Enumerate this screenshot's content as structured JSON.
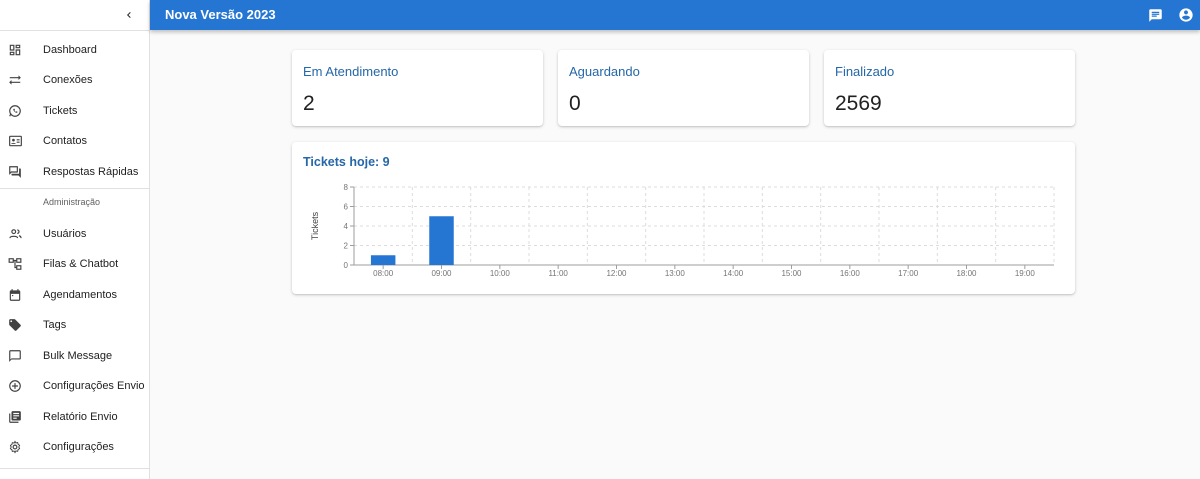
{
  "app": {
    "title": "Nova Versão 2023"
  },
  "sidebar": {
    "items": [
      {
        "label": "Dashboard",
        "icon": "dashboard-icon"
      },
      {
        "label": "Conexões",
        "icon": "sync-alt-icon"
      },
      {
        "label": "Tickets",
        "icon": "whatsapp-icon"
      },
      {
        "label": "Contatos",
        "icon": "contact-card-icon"
      },
      {
        "label": "Respostas Rápidas",
        "icon": "question-answer-icon"
      }
    ],
    "admin_header": "Administração",
    "admin_items": [
      {
        "label": "Usuários",
        "icon": "people-icon"
      },
      {
        "label": "Filas & Chatbot",
        "icon": "account-tree-icon"
      },
      {
        "label": "Agendamentos",
        "icon": "calendar-icon"
      },
      {
        "label": "Tags",
        "icon": "tag-icon"
      },
      {
        "label": "Bulk Message",
        "icon": "chat-bubble-icon"
      },
      {
        "label": "Configurações Envio",
        "icon": "add-circle-icon"
      },
      {
        "label": "Relatório Envio",
        "icon": "library-books-icon"
      },
      {
        "label": "Configurações",
        "icon": "settings-icon"
      }
    ]
  },
  "stats": [
    {
      "title": "Em Atendimento",
      "value": "2"
    },
    {
      "title": "Aguardando",
      "value": "0"
    },
    {
      "title": "Finalizado",
      "value": "2569"
    }
  ],
  "chart_title": "Tickets hoje: 9",
  "colors": {
    "accent": "#2576d2",
    "card_title": "#2567a8",
    "bar": "#2576d2"
  },
  "chart_data": {
    "type": "bar",
    "ylabel": "Tickets",
    "xlabel": "",
    "categories": [
      "08:00",
      "09:00",
      "10:00",
      "11:00",
      "12:00",
      "13:00",
      "14:00",
      "15:00",
      "16:00",
      "17:00",
      "18:00",
      "19:00"
    ],
    "values": [
      1,
      5,
      0,
      0,
      0,
      0,
      0,
      0,
      0,
      0,
      0,
      0
    ],
    "ylim": [
      0,
      8
    ],
    "yticks": [
      0,
      2,
      4,
      6,
      8
    ],
    "grid": true
  }
}
